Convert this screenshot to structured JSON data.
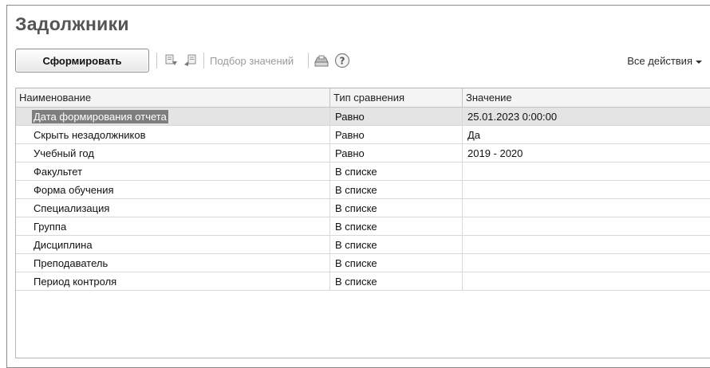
{
  "window": {
    "title": "Задолжники"
  },
  "toolbar": {
    "generate_label": "Сформировать",
    "pick_values_label": "Подбор значений",
    "all_actions_label": "Все действия"
  },
  "table": {
    "headers": [
      "Наименование",
      "Тип сравнения",
      "Значение"
    ],
    "rows": [
      {
        "name": "Дата формирования отчета",
        "comparison": "Равно",
        "value": "25.01.2023 0:00:00"
      },
      {
        "name": "Скрыть незадолжников",
        "comparison": "Равно",
        "value": "Да"
      },
      {
        "name": "Учебный год",
        "comparison": "Равно",
        "value": "2019 - 2020"
      },
      {
        "name": "Факультет",
        "comparison": "В списке",
        "value": ""
      },
      {
        "name": "Форма обучения",
        "comparison": "В списке",
        "value": ""
      },
      {
        "name": "Специализация",
        "comparison": "В списке",
        "value": ""
      },
      {
        "name": "Группа",
        "comparison": "В списке",
        "value": ""
      },
      {
        "name": "Дисциплина",
        "comparison": "В списке",
        "value": ""
      },
      {
        "name": "Преподаватель",
        "comparison": "В списке",
        "value": ""
      },
      {
        "name": "Период контроля",
        "comparison": "В списке",
        "value": ""
      }
    ]
  }
}
